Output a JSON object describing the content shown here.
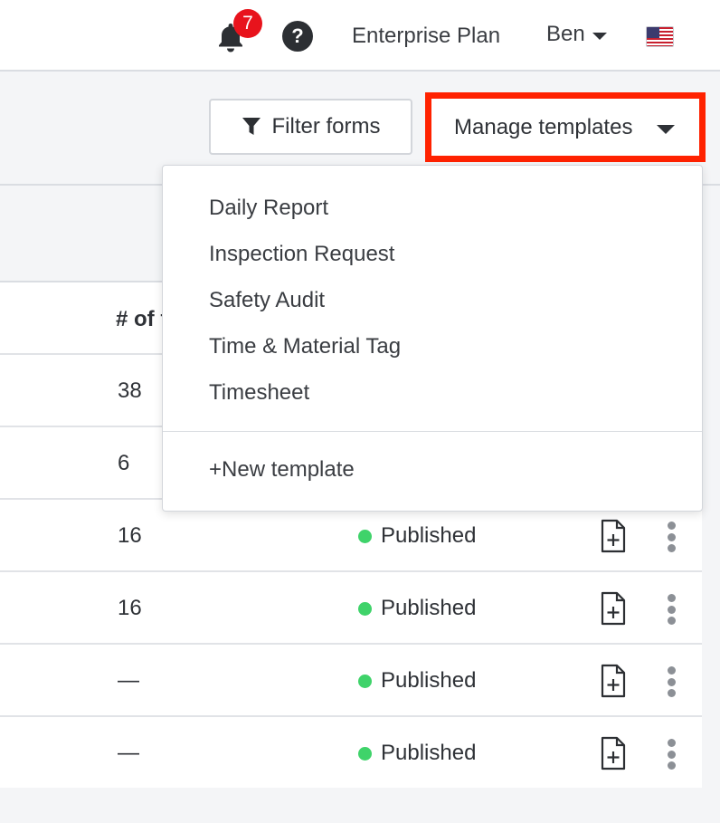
{
  "topbar": {
    "notification_count": "7",
    "help_symbol": "?",
    "plan_label": "Enterprise Plan",
    "user_name": "Ben",
    "flag": "us-flag-icon"
  },
  "toolbar": {
    "filter_label": "Filter forms",
    "manage_label": "Manage templates",
    "manage_highlight_color": "#ff2200"
  },
  "table": {
    "count_header": "# of f",
    "rows": [
      {
        "count": "38",
        "status": ""
      },
      {
        "count": "6",
        "status": ""
      },
      {
        "count": "16",
        "status": "Published"
      },
      {
        "count": "16",
        "status": "Published"
      },
      {
        "count": "—",
        "status": "Published"
      },
      {
        "count": "—",
        "status": "Published"
      }
    ],
    "status_color": "#3fd36a"
  },
  "dropdown": {
    "templates": [
      "Daily Report",
      "Inspection Request",
      "Safety Audit",
      "Time & Material Tag",
      "Timesheet"
    ],
    "new_label": "+New template"
  }
}
